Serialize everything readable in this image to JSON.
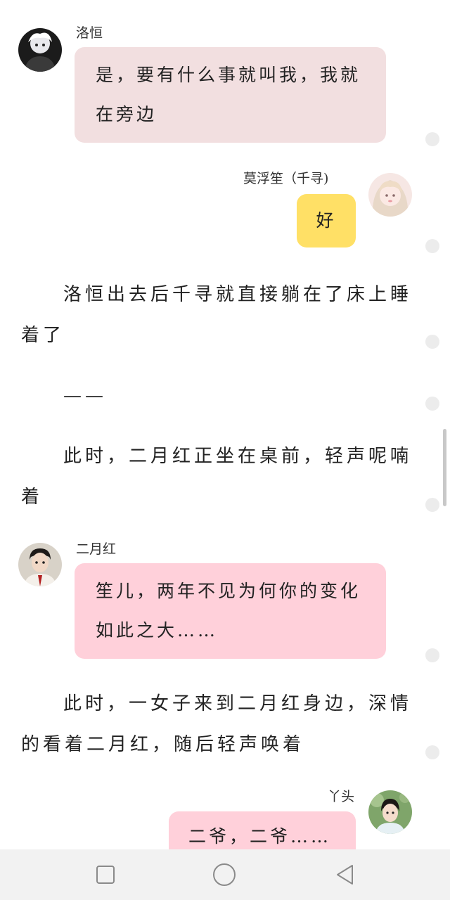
{
  "messages": [
    {
      "name": "洛恒",
      "text": "是，要有什么事就叫我，我就在旁边"
    },
    {
      "name": "莫浮笙（千寻)",
      "text": "好"
    },
    {
      "name": "二月红",
      "text": "笙儿，两年不见为何你的变化如此之大……"
    },
    {
      "name": "丫头",
      "text": "二爷，二爷……"
    }
  ],
  "narration": [
    "洛恒出去后千寻就直接躺在了床上睡着了",
    "——",
    "此时，二月红正坐在桌前，轻声呢喃着",
    "此时，一女子来到二月红身边，深情的看着二月红，随后轻声唤着"
  ],
  "colors": {
    "left_bubble_1": "#f2dfe0",
    "left_bubble_2": "#ffd0da",
    "right_bubble_yellow": "#ffe066",
    "right_bubble_pink": "#ffd0da"
  },
  "nav": {
    "icons": [
      "square-icon",
      "circle-icon",
      "triangle-back-icon"
    ]
  }
}
